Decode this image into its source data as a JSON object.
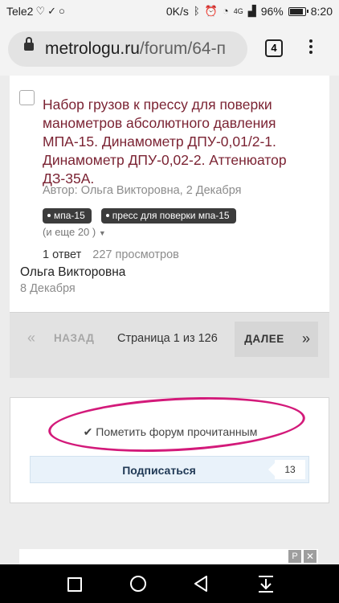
{
  "status_bar": {
    "carrier": "Tele2",
    "speed": "0K/s",
    "battery": "96%",
    "battery_level": 0.96,
    "time": "8:20",
    "signal_type": "4G"
  },
  "browser": {
    "url_host": "metrologu.ru",
    "url_path": "/forum/64-п",
    "tab_count": "4"
  },
  "topic": {
    "title": "Набор грузов к прессу для поверки манометров абсолютного давления МПА-15. Динамометр ДПУ-0,01/2-1. Динамометр ДПУ-0,02-2. Аттенюатор ДЗ-35А.",
    "meta": "Автор: Ольга Викторовна, 2 Декабря",
    "tags": [
      "мпа-15",
      "пресс для поверки мпа-15"
    ],
    "more_tags": "(и еще 20 )",
    "replies": "1 ответ",
    "views": "227 просмотров",
    "last_author": "Ольга Викторовна",
    "last_date": "8 Декабря"
  },
  "pagination": {
    "prev_label": "НАЗАД",
    "info": "Страница 1 из 126",
    "next_label": "ДАЛЕЕ"
  },
  "actions": {
    "mark_read": "Пометить форум прочитанным",
    "subscribe": "Подписаться",
    "subscribe_count": "13"
  },
  "ad": {
    "p_label": "P",
    "close_label": "✕"
  },
  "colors": {
    "title": "#7b2333",
    "annotation_circle": "#d31a7a",
    "subscribe_bg": "#e9f2fa"
  }
}
